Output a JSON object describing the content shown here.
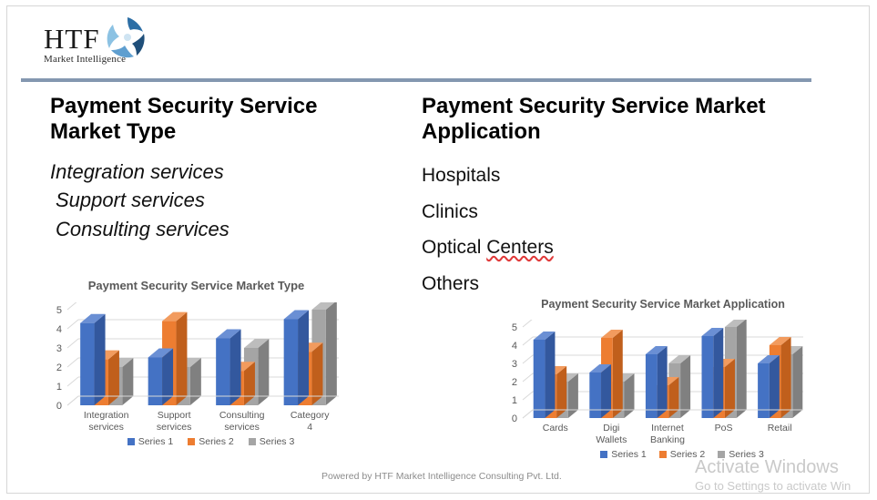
{
  "brand": {
    "logo_main": "HTF",
    "logo_sub": "Market Intelligence",
    "logo_mark": "triangular-swoosh-logo-icon",
    "divider_color": "#8497b0"
  },
  "left_column": {
    "title": "Payment Security Service Market Type",
    "items": [
      "Integration services",
      "Support services",
      "Consulting services"
    ]
  },
  "right_column": {
    "title": "Payment Security Service Market Application",
    "items": [
      "Hospitals",
      "Clinics",
      "Optical Centers",
      "Others"
    ],
    "misspelled_word": "Centers",
    "spellcheck_color": "#e03a3a"
  },
  "footer": {
    "powered_by": "Powered by HTF Market Intelligence Consulting Pvt. Ltd."
  },
  "watermark": {
    "line1": "Activate Windows",
    "line2": "Go to Settings to activate Win"
  },
  "series_colors": {
    "series1": "#4472c4",
    "series1_side": "#33589e",
    "series1_top": "#6a8fd4",
    "series2": "#ed7d31",
    "series2_side": "#c05f1c",
    "series2_top": "#f29b5e",
    "series3": "#a5a5a5",
    "series3_side": "#808080",
    "series3_top": "#bdbdbd",
    "axis_text": "#595959",
    "gridline": "#d9d9d9"
  },
  "chart_data": [
    {
      "id": "market-type-chart",
      "type": "bar",
      "title": "Payment Security Service Market Type",
      "categories": [
        "Integration services",
        "Support services",
        "Consulting services",
        "Category 4"
      ],
      "series": [
        {
          "name": "Series 1",
          "values": [
            4.3,
            2.5,
            3.5,
            4.5
          ]
        },
        {
          "name": "Series 2",
          "values": [
            2.4,
            4.4,
            1.8,
            2.8
          ]
        },
        {
          "name": "Series 3",
          "values": [
            2.0,
            2.0,
            3.0,
            5.0
          ]
        }
      ],
      "yticks": [
        0,
        1,
        2,
        3,
        4,
        5
      ],
      "ylim": [
        0,
        5
      ],
      "xlabel": "",
      "ylabel": "",
      "grid": true,
      "legend": "bottom"
    },
    {
      "id": "market-application-chart",
      "type": "bar",
      "title": "Payment Security Service Market Application",
      "categories": [
        "Cards",
        "Digi Wallets",
        "Internet Banking",
        "PoS",
        "Retail"
      ],
      "series": [
        {
          "name": "Series 1",
          "values": [
            4.3,
            2.5,
            3.5,
            4.5,
            3.0
          ]
        },
        {
          "name": "Series 2",
          "values": [
            2.4,
            4.4,
            1.8,
            2.8,
            4.0
          ]
        },
        {
          "name": "Series 3",
          "values": [
            2.0,
            2.0,
            3.0,
            5.0,
            3.5
          ]
        }
      ],
      "yticks": [
        0,
        1,
        2,
        3,
        4,
        5
      ],
      "ylim": [
        0,
        5
      ],
      "xlabel": "",
      "ylabel": "",
      "grid": true,
      "legend": "bottom"
    }
  ]
}
